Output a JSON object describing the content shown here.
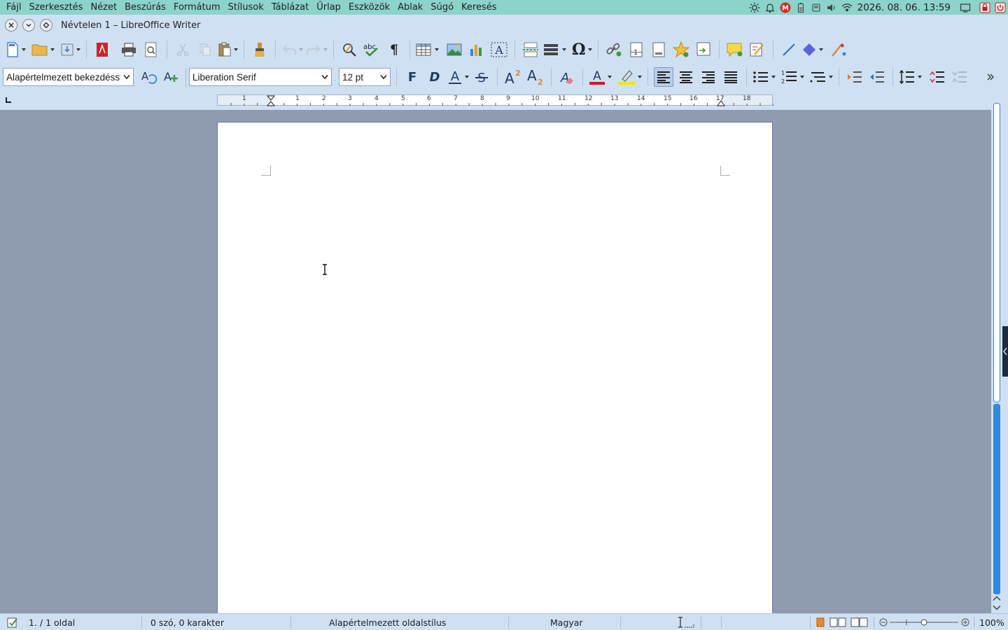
{
  "menubar": {
    "items": [
      "Fájl",
      "Szerkesztés",
      "Nézet",
      "Beszúrás",
      "Formátum",
      "Stílusok",
      "Táblázat",
      "Űrlap",
      "Eszközök",
      "Ablak",
      "Súgó",
      "Keresés"
    ]
  },
  "tray": {
    "datetime": "2026. 08. 06. 13:59",
    "icons": [
      "brightness-icon",
      "bell-icon",
      "mail-badge-icon",
      "battery-icon",
      "storage-icon",
      "volume-icon",
      "network-icon",
      "desktop-icon",
      "lock-icon",
      "power-icon"
    ]
  },
  "window": {
    "title": "Névtelen 1 – LibreOffice Writer",
    "buttons": [
      "close-icon",
      "minimize-icon",
      "maximize-icon"
    ]
  },
  "format_bar": {
    "paragraph_style": "Alapértelmezett bekezdésstílus",
    "font_name": "Liberation Serif",
    "font_size": "12 pt",
    "bold_label": "F",
    "italic_label": "D"
  },
  "ruler": {
    "labels": [
      "1",
      "1",
      "2",
      "3",
      "4",
      "5",
      "6",
      "7",
      "8",
      "9",
      "10",
      "11",
      "12",
      "13",
      "14",
      "15",
      "16",
      "17",
      "18"
    ]
  },
  "statusbar": {
    "page": "1. / 1 oldal",
    "words": "0 szó, 0 karakter",
    "page_style": "Alapértelmezett oldalstílus",
    "language": "Magyar",
    "zoom": "100%",
    "zoom_level": 1.0
  },
  "colors": {
    "topbar": "#8cd3c9",
    "chrome": "#cfe0f3",
    "doc_background": "#8f9bb0",
    "accent": "#2f8ae0",
    "font_color_bar": "#d01c1c",
    "highlight_bar": "#f5e600"
  }
}
